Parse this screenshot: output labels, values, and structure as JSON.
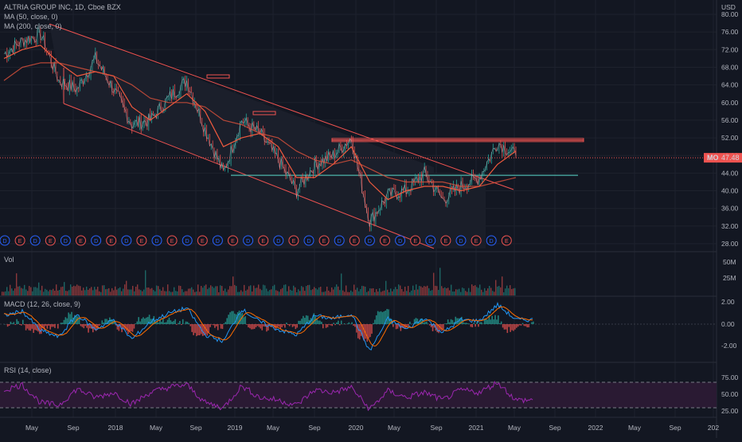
{
  "header": {
    "symbol_line": "ALTRIA GROUP INC, 1D, Cboe BZX",
    "ma50": "MA (50, close, 0)",
    "ma200": "MA (200, close, 0)",
    "currency": "USD",
    "price_tag_symbol": "MO",
    "price_tag_value": "47.48"
  },
  "indicators": {
    "vol": "Vol",
    "macd": "MACD (12, 26, close, 9)",
    "rsi": "RSI (14, close)"
  },
  "colors": {
    "background": "#131722",
    "up": "#26a69a",
    "down": "#ef5350",
    "ma": "#f05a3e",
    "support": "#4db6ac",
    "rsi": "#9c27b0",
    "macd_line": "#2196f3",
    "signal_line": "#ff6d00"
  },
  "chart_data": {
    "type": "line",
    "title": "ALTRIA GROUP INC, 1D, Cboe BZX",
    "y_ticks": [
      "80.00",
      "76.00",
      "72.00",
      "68.00",
      "64.00",
      "60.00",
      "56.00",
      "52.00",
      "48.00",
      "44.00",
      "40.00",
      "36.00",
      "32.00",
      "28.00"
    ],
    "ylim": [
      28,
      80
    ],
    "x_ticks": [
      "May",
      "Sep",
      "2018",
      "May",
      "Sep",
      "2019",
      "May",
      "Sep",
      "2020",
      "May",
      "Sep",
      "2021",
      "May",
      "Sep",
      "2022",
      "May",
      "Sep",
      "202"
    ],
    "price_series": {
      "name": "MO",
      "x": [
        "2017-04",
        "2017-06",
        "2017-07",
        "2017-09",
        "2017-11",
        "2018-01",
        "2018-03",
        "2018-05",
        "2018-07",
        "2018-09",
        "2018-10",
        "2018-12",
        "2019-01",
        "2019-03",
        "2019-05",
        "2019-07",
        "2019-08",
        "2019-10",
        "2019-12",
        "2020-01",
        "2020-03",
        "2020-04",
        "2020-06",
        "2020-08",
        "2020-10",
        "2020-11",
        "2021-01",
        "2021-03",
        "2021-04"
      ],
      "values": [
        71,
        74,
        75.5,
        65,
        63,
        70,
        63,
        55,
        56,
        61,
        65,
        54,
        44,
        56,
        53,
        47,
        40,
        46,
        48,
        52,
        33,
        39,
        40,
        44,
        38,
        41,
        43,
        51,
        48
      ]
    },
    "ma50_values": [
      70,
      72,
      73,
      69,
      66,
      67,
      66,
      59,
      56,
      59,
      62,
      58,
      50,
      52,
      53,
      50,
      43,
      43,
      46,
      50,
      42,
      38,
      40,
      41,
      41,
      40,
      41,
      46,
      49
    ],
    "ma200_values": [
      65,
      68,
      69,
      69,
      68,
      67,
      66,
      64,
      61,
      60,
      60,
      59,
      56,
      55,
      53,
      52,
      49,
      47,
      46,
      47,
      45,
      43,
      42,
      42,
      42,
      41,
      41,
      42,
      43
    ],
    "levels": {
      "resistance": 51.5,
      "support": 43.5,
      "current": 47.48
    },
    "events": [
      "D",
      "E",
      "D",
      "E",
      "D",
      "E",
      "D",
      "E",
      "D",
      "E",
      "D",
      "E",
      "D",
      "E",
      "D",
      "E",
      "D",
      "E",
      "D",
      "E",
      "D",
      "E",
      "D",
      "E",
      "D",
      "E",
      "D",
      "E",
      "D",
      "E",
      "D",
      "E",
      "D",
      "E"
    ],
    "volume_ticks": [
      "50M",
      "25M"
    ],
    "macd_ticks": [
      "2.00",
      "0.00",
      "-2.00"
    ],
    "macd_values": [
      0.8,
      1.2,
      -0.6,
      -1.2,
      0.9,
      -0.5,
      0.4,
      -1.4,
      0.2,
      1.0,
      1.5,
      -1.0,
      -1.6,
      1.4,
      0.2,
      -0.5,
      -1.0,
      0.8,
      0.5,
      1.0,
      -2.5,
      0.5,
      -0.5,
      0.6,
      -0.8,
      0.4,
      0.3,
      1.8,
      0.4
    ],
    "rsi_ticks": [
      "75.00",
      "50.00",
      "25.00"
    ],
    "rsi_values": [
      60,
      70,
      35,
      30,
      62,
      45,
      55,
      32,
      55,
      65,
      70,
      35,
      25,
      68,
      45,
      40,
      30,
      60,
      55,
      65,
      22,
      58,
      45,
      55,
      40,
      60,
      55,
      75,
      40
    ]
  }
}
